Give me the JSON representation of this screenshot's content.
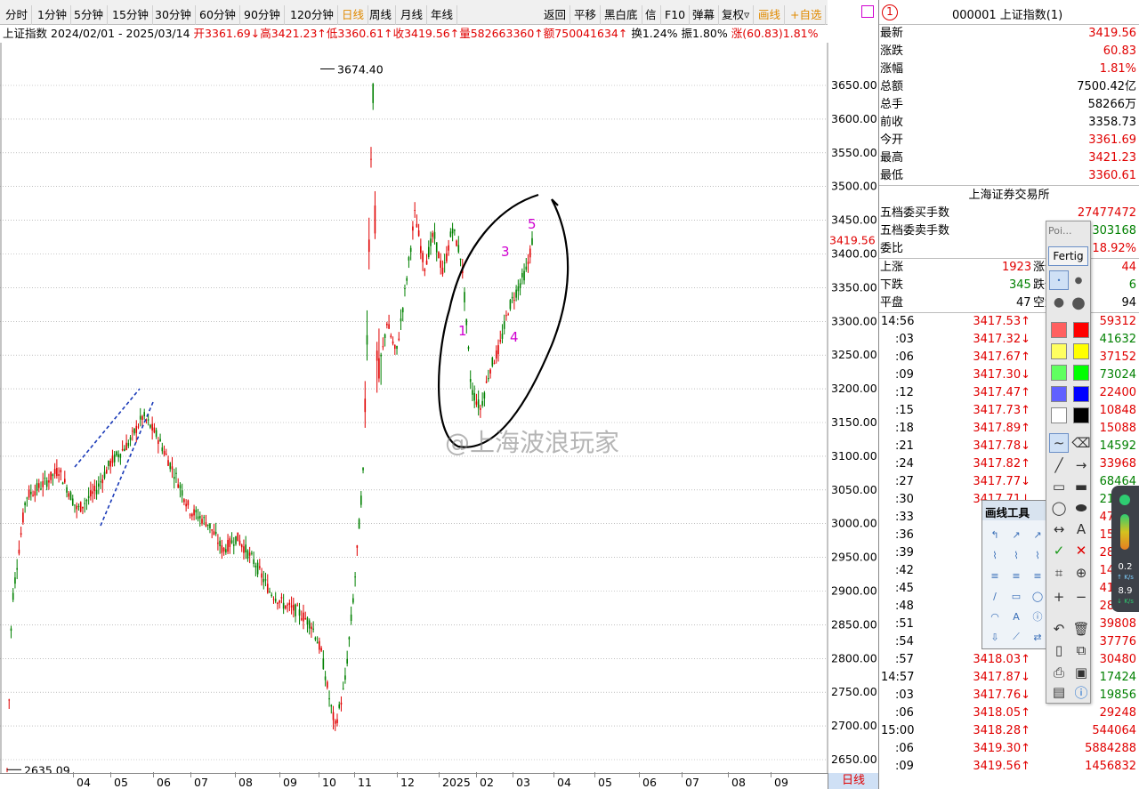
{
  "toolbar": {
    "periods": [
      "分时",
      "1分钟",
      "5分钟",
      "15分钟",
      "30分钟",
      "60分钟",
      "90分钟",
      "120分钟",
      "日线",
      "周线",
      "月线",
      "年线"
    ],
    "active_period": "日线",
    "actions": [
      "返回",
      "平移",
      "黑白底",
      "信",
      "F10",
      "弹幕",
      "复权▿",
      "画线",
      "+自选"
    ]
  },
  "info_line": {
    "name": "上证指数",
    "range": "2024/02/01 - 2025/03/14",
    "open": "开3361.69↓",
    "high": "高3421.23↑",
    "low": "低3360.61↑",
    "close": "收3419.56↑",
    "volume": "量582663360↑",
    "amount": "额750041634↑",
    "turnover": "换1.24%",
    "amplitude": "振1.80%",
    "change": "涨(60.83)1.81%"
  },
  "chart_data": {
    "type": "candlestick",
    "title": "上证指数 2024/02/01 - 2025/03/14",
    "ylim": [
      2620,
      3720
    ],
    "y_ticks": [
      "3650.00",
      "3600.00",
      "3550.00",
      "3500.00",
      "3450.00",
      "3400.00",
      "3350.00",
      "3300.00",
      "3250.00",
      "3200.00",
      "3150.00",
      "3100.00",
      "3050.00",
      "3000.00",
      "2950.00",
      "2900.00",
      "2850.00",
      "2800.00",
      "2750.00",
      "2700.00",
      "2650.00"
    ],
    "x_ticks": [
      "04",
      "05",
      "06",
      "07",
      "08",
      "09",
      "10",
      "11",
      "12",
      "2025",
      "02",
      "03",
      "04",
      "05",
      "06",
      "07",
      "08",
      "09"
    ],
    "max_label": "3674.40",
    "min_label": "2635.09",
    "last_price_label": "3419.56",
    "path": [
      [
        2024.09,
        2635
      ],
      [
        2024.1,
        2880
      ],
      [
        2024.13,
        3040
      ],
      [
        2024.17,
        3060
      ],
      [
        2024.2,
        3080
      ],
      [
        2024.24,
        3020
      ],
      [
        2024.28,
        3050
      ],
      [
        2024.31,
        3090
      ],
      [
        2024.35,
        3120
      ],
      [
        2024.38,
        3160
      ],
      [
        2024.41,
        3130
      ],
      [
        2024.45,
        3070
      ],
      [
        2024.48,
        3020
      ],
      [
        2024.52,
        3000
      ],
      [
        2024.55,
        2960
      ],
      [
        2024.58,
        2980
      ],
      [
        2024.62,
        2940
      ],
      [
        2024.65,
        2900
      ],
      [
        2024.68,
        2880
      ],
      [
        2024.71,
        2870
      ],
      [
        2024.74,
        2850
      ],
      [
        2024.76,
        2810
      ],
      [
        2024.78,
        2730
      ],
      [
        2024.79,
        2700
      ],
      [
        2024.81,
        2760
      ],
      [
        2024.83,
        2900
      ],
      [
        2024.85,
        3080
      ],
      [
        2024.86,
        3350
      ],
      [
        2024.87,
        3674
      ],
      [
        2024.88,
        3200
      ],
      [
        2024.9,
        3300
      ],
      [
        2024.92,
        3250
      ],
      [
        2024.94,
        3350
      ],
      [
        2024.96,
        3460
      ],
      [
        2024.98,
        3380
      ],
      [
        2025.0,
        3430
      ],
      [
        2025.02,
        3370
      ],
      [
        2025.04,
        3440
      ],
      [
        2025.06,
        3390
      ],
      [
        2025.08,
        3200
      ],
      [
        2025.1,
        3170
      ],
      [
        2025.12,
        3230
      ],
      [
        2025.14,
        3260
      ],
      [
        2025.16,
        3320
      ],
      [
        2025.18,
        3350
      ],
      [
        2025.2,
        3380
      ],
      [
        2025.21,
        3419
      ]
    ],
    "up_color": "#e00000",
    "down_color": "#008000",
    "annotations": [
      "1",
      "3",
      "4",
      "5"
    ]
  },
  "watermark": "@上海波浪玩家",
  "xaxis_tab": "日线",
  "right_panel": {
    "badge": "1",
    "title": "000001 上证指数(1)",
    "stats": [
      {
        "label": "最新",
        "value": "3419.56",
        "color": "red"
      },
      {
        "label": "涨跌",
        "value": "60.83",
        "color": "red"
      },
      {
        "label": "涨幅",
        "value": "1.81%",
        "color": "red"
      },
      {
        "label": "总额",
        "value": "7500.42亿",
        "color": "black"
      },
      {
        "label": "总手",
        "value": "58266万",
        "color": "black"
      },
      {
        "label": "前收",
        "value": "3358.73",
        "color": "black"
      },
      {
        "label": "今开",
        "value": "3361.69",
        "color": "red"
      },
      {
        "label": "最高",
        "value": "3421.23",
        "color": "red"
      },
      {
        "label": "最低",
        "value": "3360.61",
        "color": "red"
      }
    ],
    "exchange": "上海证券交易所",
    "orders": [
      {
        "label": "五档委买手数",
        "value": "27477472",
        "color": "red"
      },
      {
        "label": "五档委卖手数",
        "value": "303168",
        "color": "grn"
      },
      {
        "label": "委比",
        "value": "18.92%",
        "color": "red"
      }
    ],
    "breadth": {
      "up_label": "上涨",
      "up": "1923",
      "limit_up_label": "涨停",
      "limit_up": "44",
      "down_label": "下跌",
      "down": "345",
      "limit_down_label": "跌停",
      "limit_down": "6",
      "flat_label": "平盘",
      "flat": "47",
      "suspended_label": "空盘",
      "suspended": "94"
    },
    "ticks": [
      {
        "t": "14:56",
        "p": "3417.53↑",
        "v": "59312",
        "vc": "red"
      },
      {
        "t": ":03",
        "p": "3417.32↓",
        "v": "41632",
        "vc": "grn"
      },
      {
        "t": ":06",
        "p": "3417.67↑",
        "v": "37152",
        "vc": "red"
      },
      {
        "t": ":09",
        "p": "3417.30↓",
        "v": "73024",
        "vc": "grn"
      },
      {
        "t": ":12",
        "p": "3417.47↑",
        "v": "22400",
        "vc": "red"
      },
      {
        "t": ":15",
        "p": "3417.73↑",
        "v": "10848",
        "vc": "red"
      },
      {
        "t": ":18",
        "p": "3417.89↑",
        "v": "15088",
        "vc": "red"
      },
      {
        "t": ":21",
        "p": "3417.78↓",
        "v": "14592",
        "vc": "grn"
      },
      {
        "t": ":24",
        "p": "3417.82↑",
        "v": "33968",
        "vc": "red"
      },
      {
        "t": ":27",
        "p": "3417.77↓",
        "v": "68464",
        "vc": "grn"
      },
      {
        "t": ":30",
        "p": "3417.71↓",
        "v": "21952",
        "vc": "grn"
      },
      {
        "t": ":33",
        "p": "3417.",
        "v": "47760",
        "vc": "red"
      },
      {
        "t": ":36",
        "p": "3417.",
        "v": "15120",
        "vc": "red"
      },
      {
        "t": ":39",
        "p": "3417.",
        "v": "28256",
        "vc": "red"
      },
      {
        "t": ":42",
        "p": "3417.",
        "v": "14224",
        "vc": "red"
      },
      {
        "t": ":45",
        "p": "3417.",
        "v": "41664",
        "vc": "red"
      },
      {
        "t": ":48",
        "p": "3417.",
        "v": "28320",
        "vc": "red"
      },
      {
        "t": ":51",
        "p": "3417.",
        "v": "39808",
        "vc": "red"
      },
      {
        "t": ":54",
        "p": "3417.",
        "v": "37776",
        "vc": "red"
      },
      {
        "t": ":57",
        "p": "3418.03↑",
        "v": "30480",
        "vc": "red"
      },
      {
        "t": "14:57",
        "p": "3417.87↓",
        "v": "17424",
        "vc": "grn"
      },
      {
        "t": ":03",
        "p": "3417.76↓",
        "v": "19856",
        "vc": "grn"
      },
      {
        "t": ":06",
        "p": "3418.05↑",
        "v": "29248",
        "vc": "red"
      },
      {
        "t": "15:00",
        "p": "3418.28↑",
        "v": "544064",
        "vc": "red"
      },
      {
        "t": ":06",
        "p": "3419.30↑",
        "v": "5884288",
        "vc": "red"
      },
      {
        "t": ":09",
        "p": "3419.56↑",
        "v": "1456832",
        "vc": "red"
      }
    ]
  },
  "palette": {
    "title": "Poi...",
    "button": "Fertig",
    "colors": [
      "#ff6060",
      "#ff0000",
      "#ffff60",
      "#ffff00",
      "#60ff60",
      "#00ff00",
      "#6060ff",
      "#0000ff",
      "#ffffff",
      "#000000"
    ]
  },
  "drawtools": {
    "title": "画线工具"
  },
  "speed": {
    "up": "0.2",
    "up_unit": "↑ K/s",
    "down": "8.9",
    "down_unit": "↓ K/s"
  }
}
